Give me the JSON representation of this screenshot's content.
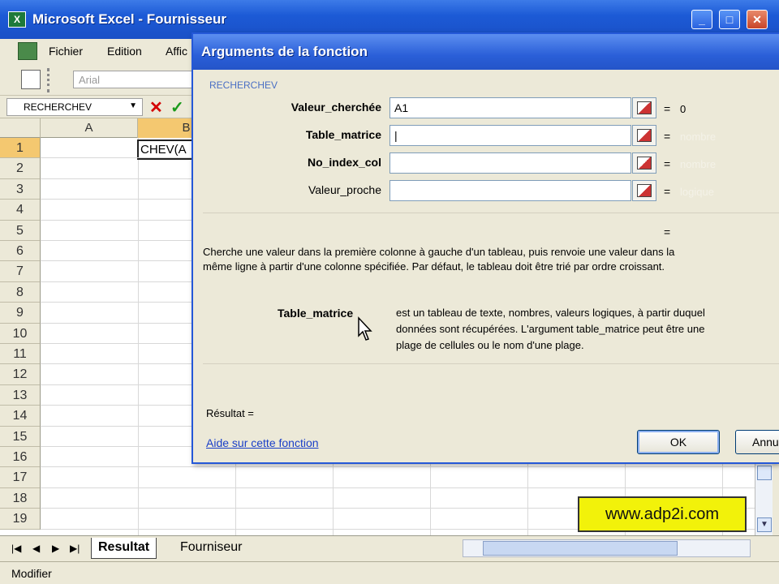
{
  "window": {
    "title": "Microsoft Excel - Fournisseur",
    "app_icon": "X",
    "minimize": "_",
    "maximize": "□",
    "close": "✕"
  },
  "menu": {
    "items": [
      "Fichier",
      "Edition",
      "Affic"
    ]
  },
  "toolbar": {
    "font_name": "Arial"
  },
  "formula_bar": {
    "name_box": "RECHERCHEV",
    "cancel_symbol": "✕",
    "confirm_symbol": "✓"
  },
  "grid": {
    "columns": [
      "A",
      "B"
    ],
    "rows": [
      "1",
      "2",
      "3",
      "4",
      "5",
      "6",
      "7",
      "8",
      "9",
      "10",
      "11",
      "12",
      "13",
      "14",
      "15",
      "16",
      "17",
      "18",
      "19"
    ],
    "active_cell_text": "CHEV(A"
  },
  "sheets": {
    "tabs": [
      "Resultat",
      "Fourniseur"
    ],
    "active": "Resultat"
  },
  "status": {
    "mode": "Modifier"
  },
  "watermark": {
    "text": "www.adp2i.com"
  },
  "dialog": {
    "title": "Arguments de la fonction",
    "function_name": "RECHERCHEV",
    "args": [
      {
        "label": "Valeur_cherchée",
        "value": "A1",
        "result": "0",
        "required": true
      },
      {
        "label": "Table_matrice",
        "value": "|",
        "result": "nombre",
        "required": true
      },
      {
        "label": "No_index_col",
        "value": "",
        "result": "nombre",
        "required": true
      },
      {
        "label": "Valeur_proche",
        "value": "",
        "result": "logique",
        "required": false
      }
    ],
    "total_equals": "=",
    "description_line1": "Cherche une valeur dans la première colonne à gauche d'un tableau, puis renvoie une valeur dans la",
    "description_line2": "même ligne à partir d'une colonne spécifiée. Par défaut, le tableau doit être trié par ordre croissant.",
    "current_arg_name": "Table_matrice",
    "current_arg_desc_line1": "est un tableau de texte, nombres, valeurs logiques, à partir duquel",
    "current_arg_desc_line2": "données sont récupérées. L'argument table_matrice peut être une",
    "current_arg_desc_line3": "plage de cellules ou le nom d'une plage.",
    "result_label": "Résultat =",
    "help_link": "Aide sur cette fonction",
    "ok_label": "OK",
    "cancel_label": "Annuler"
  },
  "colors": {
    "titlebar": "#1c5ad6",
    "active_header": "#f4c870",
    "watermark_bg": "#f2f20a",
    "link": "#1a3fc8"
  }
}
